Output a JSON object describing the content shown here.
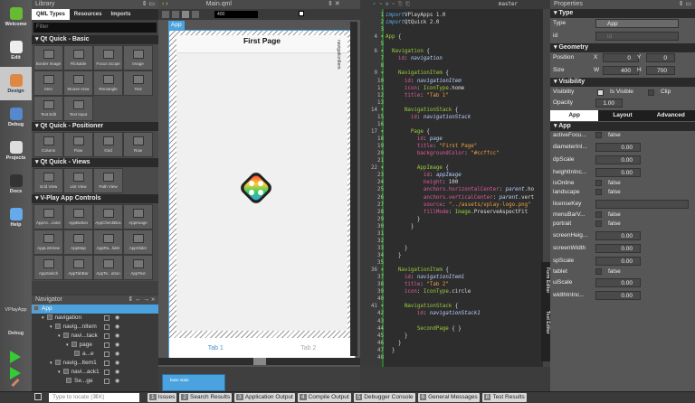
{
  "modes": [
    "Welcome",
    "Edit",
    "Design",
    "Debug",
    "Projects",
    "Docs",
    "Help"
  ],
  "active_mode": "Design",
  "kit": {
    "project": "VPlayApp",
    "mode": "Debug"
  },
  "library": {
    "title": "Library",
    "tabs": [
      "QML Types",
      "Resources",
      "Imports"
    ],
    "filter_placeholder": "Filter",
    "sections": [
      {
        "title": "Qt Quick - Basic",
        "items": [
          "Border Image",
          "Flickable",
          "Focus Scope",
          "Image",
          "Item",
          "Mouse Area",
          "Rectangle",
          "Text",
          "Text Edit",
          "Text Input"
        ]
      },
      {
        "title": "Qt Quick - Positioner",
        "items": [
          "Column",
          "Flow",
          "Grid",
          "Row"
        ]
      },
      {
        "title": "Qt Quick - Views",
        "items": [
          "Grid View",
          "List View",
          "Path View"
        ]
      },
      {
        "title": "V-Play App Controls",
        "items": [
          "AppAc...cator",
          "AppButton",
          "AppCheckBox",
          "AppImage",
          "AppListView",
          "AppMap",
          "AppRa...lider",
          "AppSlider",
          "AppSwitch",
          "AppTabBar",
          "AppTe...utton",
          "AppText"
        ]
      }
    ]
  },
  "navigator": {
    "title": "Navigator",
    "items": [
      {
        "label": "App",
        "depth": 0,
        "selected": true
      },
      {
        "label": "navigation",
        "depth": 1
      },
      {
        "label": "navig...nItem",
        "depth": 2
      },
      {
        "label": "navi...tack",
        "depth": 3
      },
      {
        "label": "page",
        "depth": 4
      },
      {
        "label": "a...e",
        "depth": 5
      },
      {
        "label": "navig...Item1",
        "depth": 2
      },
      {
        "label": "navi...ack1",
        "depth": 3
      },
      {
        "label": "Se...ge",
        "depth": 4
      }
    ]
  },
  "form": {
    "file": "Main.qml",
    "width_value": "400",
    "app_label": "App",
    "page_title": "First Page",
    "nav_label": "navigationItem",
    "tabs": [
      "Tab 1",
      "Tab 2"
    ],
    "state": "base state",
    "side_tabs": [
      "Form Editor",
      "Text Editor"
    ]
  },
  "editor": {
    "branch": "master",
    "lines": [
      [
        [
          "kw",
          "import"
        ],
        [
          "",
          "VPlayApps 1.0"
        ]
      ],
      [
        [
          "kw",
          "import"
        ],
        [
          "",
          "QtQuick 2.0"
        ]
      ],
      [],
      [
        [
          "ty",
          "App"
        ],
        [
          "",
          " {"
        ]
      ],
      [],
      [
        [
          "ty",
          "  Navigation"
        ],
        [
          "",
          " {"
        ]
      ],
      [
        [
          "pr",
          "    id"
        ],
        [
          "",
          ": "
        ],
        [
          "idv",
          "navigation"
        ]
      ],
      [],
      [
        [
          "ty",
          "    NavigationItem"
        ],
        [
          "",
          " {"
        ]
      ],
      [
        [
          "pr",
          "      id"
        ],
        [
          "",
          ": "
        ],
        [
          "idv",
          "navigationItem"
        ]
      ],
      [
        [
          "pr",
          "      icon"
        ],
        [
          "",
          ": "
        ],
        [
          "ty",
          "IconType"
        ],
        [
          "",
          ".home"
        ]
      ],
      [
        [
          "pr",
          "      title"
        ],
        [
          "",
          ": "
        ],
        [
          "st",
          "\"Tab 1\""
        ]
      ],
      [],
      [
        [
          "ty",
          "      NavigationStack"
        ],
        [
          "",
          " {"
        ]
      ],
      [
        [
          "pr",
          "        id"
        ],
        [
          "",
          ": "
        ],
        [
          "idv",
          "navigationStack"
        ]
      ],
      [],
      [
        [
          "ty",
          "        Page"
        ],
        [
          "",
          " {"
        ]
      ],
      [
        [
          "pr",
          "          id"
        ],
        [
          "",
          ": "
        ],
        [
          "idv",
          "page"
        ]
      ],
      [
        [
          "pr",
          "          title"
        ],
        [
          "",
          ": "
        ],
        [
          "st",
          "\"First Page\""
        ]
      ],
      [
        [
          "pr",
          "          backgroundColor"
        ],
        [
          "",
          ": "
        ],
        [
          "st",
          "\"#ccffcc\""
        ]
      ],
      [],
      [
        [
          "ty",
          "          AppImage"
        ],
        [
          "",
          " {"
        ]
      ],
      [
        [
          "pr",
          "            id"
        ],
        [
          "",
          ": "
        ],
        [
          "idv",
          "appImage"
        ]
      ],
      [
        [
          "pr",
          "            height"
        ],
        [
          "",
          ": 100"
        ]
      ],
      [
        [
          "pr",
          "            anchors.horizontalCenter"
        ],
        [
          "",
          ": "
        ],
        [
          "idv",
          "parent"
        ],
        [
          "",
          ".ho"
        ]
      ],
      [
        [
          "pr",
          "            anchors.verticalCenter"
        ],
        [
          "",
          ": "
        ],
        [
          "idv",
          "parent"
        ],
        [
          "",
          ".vert"
        ]
      ],
      [
        [
          "pr",
          "            source"
        ],
        [
          "",
          ": "
        ],
        [
          "st",
          "\"../assets/vplay-logo.png\""
        ]
      ],
      [
        [
          "pr",
          "            fillMode"
        ],
        [
          "",
          ": "
        ],
        [
          "ty",
          "Image"
        ],
        [
          "",
          ".PreserveAspectFit"
        ]
      ],
      [
        [
          "",
          "          }"
        ]
      ],
      [
        [
          "",
          "        }"
        ]
      ],
      [],
      [],
      [
        [
          "",
          "      }"
        ]
      ],
      [
        [
          "",
          "    }"
        ]
      ],
      [],
      [
        [
          "ty",
          "    NavigationItem"
        ],
        [
          "",
          " {"
        ]
      ],
      [
        [
          "pr",
          "      id"
        ],
        [
          "",
          ": "
        ],
        [
          "idv",
          "navigationItem1"
        ]
      ],
      [
        [
          "pr",
          "      title"
        ],
        [
          "",
          ": "
        ],
        [
          "st",
          "\"Tab 2\""
        ]
      ],
      [
        [
          "pr",
          "      icon"
        ],
        [
          "",
          ": "
        ],
        [
          "ty",
          "IconType"
        ],
        [
          "",
          ".circle"
        ]
      ],
      [],
      [
        [
          "ty",
          "      NavigationStack"
        ],
        [
          "",
          " {"
        ]
      ],
      [
        [
          "pr",
          "          id"
        ],
        [
          "",
          ": "
        ],
        [
          "idv",
          "navigationStack1"
        ]
      ],
      [],
      [
        [
          "ty",
          "          SecondPage"
        ],
        [
          "",
          " { }"
        ]
      ],
      [
        [
          "",
          "      }"
        ]
      ],
      [
        [
          "",
          "    }"
        ]
      ],
      [
        [
          "",
          "  }"
        ]
      ],
      []
    ]
  },
  "properties": {
    "title": "Properties",
    "type": {
      "section": "Type",
      "type_label": "Type",
      "type_value": "App",
      "id_label": "id",
      "id_placeholder": "id"
    },
    "geometry": {
      "section": "Geometry",
      "position_label": "Position",
      "x_label": "X",
      "x": "0",
      "y_label": "Y",
      "y": "0",
      "size_label": "Size",
      "w_label": "W",
      "w": "400",
      "h_label": "H",
      "h": "700"
    },
    "visibility": {
      "section": "Visibility",
      "label": "Visibility",
      "is_visible": "Is Visible",
      "clip": "Clip",
      "opacity_label": "Opacity",
      "opacity": "1.00"
    },
    "tabs": [
      "App",
      "Layout",
      "Advanced"
    ],
    "app_section": "App",
    "app_rows": [
      {
        "name": "activeFocu...",
        "kind": "check",
        "value": "false"
      },
      {
        "name": "diameterInI...",
        "kind": "num",
        "value": "0.00"
      },
      {
        "name": "dpScale",
        "kind": "num",
        "value": "0.00"
      },
      {
        "name": "heightInInc...",
        "kind": "num",
        "value": "0.00"
      },
      {
        "name": "isOnline",
        "kind": "check",
        "value": "false"
      },
      {
        "name": "landscape",
        "kind": "check",
        "value": "false"
      },
      {
        "name": "licenseKey",
        "kind": "text",
        "value": ""
      },
      {
        "name": "menuBarV...",
        "kind": "check",
        "value": "false"
      },
      {
        "name": "portrait",
        "kind": "check",
        "value": "false"
      },
      {
        "name": "screenHeig...",
        "kind": "num",
        "value": "0.00"
      },
      {
        "name": "screenWidth",
        "kind": "num",
        "value": "0.00"
      },
      {
        "name": "spScale",
        "kind": "num",
        "value": "0.00"
      },
      {
        "name": "tablet",
        "kind": "check",
        "value": "false"
      },
      {
        "name": "uiScale",
        "kind": "num",
        "value": "0.00"
      },
      {
        "name": "widthInInc...",
        "kind": "num",
        "value": "0.00"
      }
    ]
  },
  "status": {
    "locate_placeholder": "Type to locate (⌘K)",
    "panes": [
      {
        "n": "1",
        "label": "Issues"
      },
      {
        "n": "2",
        "label": "Search Results"
      },
      {
        "n": "3",
        "label": "Application Output"
      },
      {
        "n": "4",
        "label": "Compile Output"
      },
      {
        "n": "5",
        "label": "Debugger Console"
      },
      {
        "n": "6",
        "label": "General Messages"
      },
      {
        "n": "8",
        "label": "Test Results"
      }
    ]
  },
  "colors": {
    "accent": "#4aa3df",
    "keyword": "#5fa8e8",
    "type": "#9ccc3c",
    "property": "#e05a9c",
    "string": "#f0a040"
  }
}
